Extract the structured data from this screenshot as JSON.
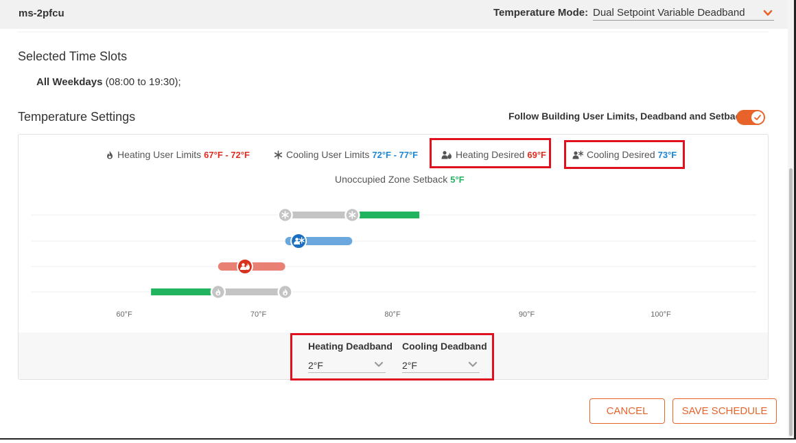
{
  "header": {
    "device_name": "ms-2pfcu",
    "mode_label": "Temperature Mode:",
    "mode_value": "Dual Setpoint Variable Deadband"
  },
  "time_slots": {
    "title": "Selected Time Slots",
    "day": "All Weekdays",
    "range": " (08:00 to 19:30);"
  },
  "temperature_settings": {
    "title": "Temperature Settings",
    "follow_label": "Follow Building User Limits, Deadband and Setback",
    "follow_enabled": true
  },
  "legend": {
    "heating_limits_label": "Heating User Limits",
    "heating_limits_value": "67°F - 72°F",
    "cooling_limits_label": "Cooling User Limits",
    "cooling_limits_value": "72°F - 77°F",
    "heating_desired_label": "Heating Desired",
    "heating_desired_value": "69°F",
    "cooling_desired_label": "Cooling Desired",
    "cooling_desired_value": "73°F",
    "setback_label": "Unoccupied Zone Setback",
    "setback_value": "5°F"
  },
  "chart_data": {
    "type": "range-slider",
    "x_ticks": [
      "60°F",
      "70°F",
      "80°F",
      "90°F",
      "100°F"
    ],
    "x_range": [
      53,
      107
    ],
    "rows": [
      {
        "name": "cooling-limits",
        "range": [
          72,
          77
        ],
        "setback_to": 82,
        "handles": "snowflake"
      },
      {
        "name": "cooling-desired",
        "range": [
          72,
          77
        ],
        "value": 73
      },
      {
        "name": "heating-desired",
        "range": [
          67,
          72
        ],
        "value": 69
      },
      {
        "name": "heating-limits",
        "range": [
          67,
          72
        ],
        "setback_to": 62,
        "handles": "flame"
      }
    ],
    "colors": {
      "grey": "#c4c4c4",
      "green": "#22b35e",
      "blue_track": "#6aa7dc",
      "blue_handle": "#1a6fc0",
      "red_track": "#e88074",
      "red_handle": "#d8321e"
    }
  },
  "deadband": {
    "heating_label": "Heating Deadband",
    "heating_value": "2°F",
    "cooling_label": "Cooling Deadband",
    "cooling_value": "2°F"
  },
  "buttons": {
    "cancel": "CANCEL",
    "save": "SAVE SCHEDULE"
  },
  "colors": {
    "accent": "#e8632a",
    "highlight": "#e0101f"
  }
}
